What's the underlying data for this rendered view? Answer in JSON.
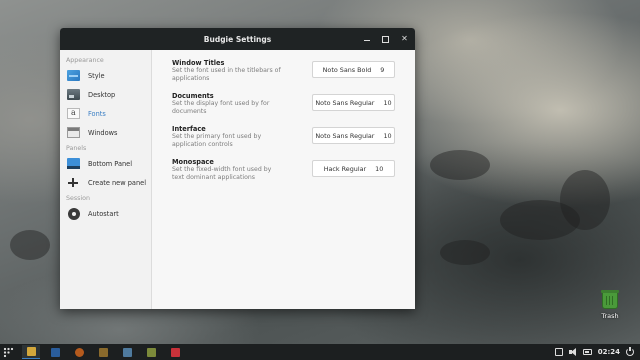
{
  "window": {
    "title": "Budgie Settings"
  },
  "sidebar": {
    "sections": [
      {
        "label": "Appearance",
        "items": [
          {
            "label": "Style",
            "icon": "style-icon"
          },
          {
            "label": "Desktop",
            "icon": "desktop-icon"
          },
          {
            "label": "Fonts",
            "icon": "fonts-icon",
            "active": true
          },
          {
            "label": "Windows",
            "icon": "windows-icon"
          }
        ]
      },
      {
        "label": "Panels",
        "items": [
          {
            "label": "Bottom Panel",
            "icon": "panel-icon"
          },
          {
            "label": "Create new panel",
            "icon": "plus-icon"
          }
        ]
      },
      {
        "label": "Session",
        "items": [
          {
            "label": "Autostart",
            "icon": "gear-icon"
          }
        ]
      }
    ]
  },
  "fonts": {
    "rows": [
      {
        "title": "Window Titles",
        "desc1": "Set the font used in the titlebars of",
        "desc2": "applications",
        "font": "Noto Sans Bold",
        "size": "9"
      },
      {
        "title": "Documents",
        "desc1": "Set the display font used by for",
        "desc2": "documents",
        "font": "Noto Sans Regular",
        "size": "10"
      },
      {
        "title": "Interface",
        "desc1": "Set the primary font used by",
        "desc2": "application controls",
        "font": "Noto Sans Regular",
        "size": "10"
      },
      {
        "title": "Monospace",
        "desc1": "Set the fixed-width font used by",
        "desc2": "text dominant applications",
        "font": "Hack Regular",
        "size": "10"
      }
    ]
  },
  "desktop": {
    "trash_label": "Trash"
  },
  "panel": {
    "clock": "02:24",
    "accent": "#3b7fc4"
  }
}
